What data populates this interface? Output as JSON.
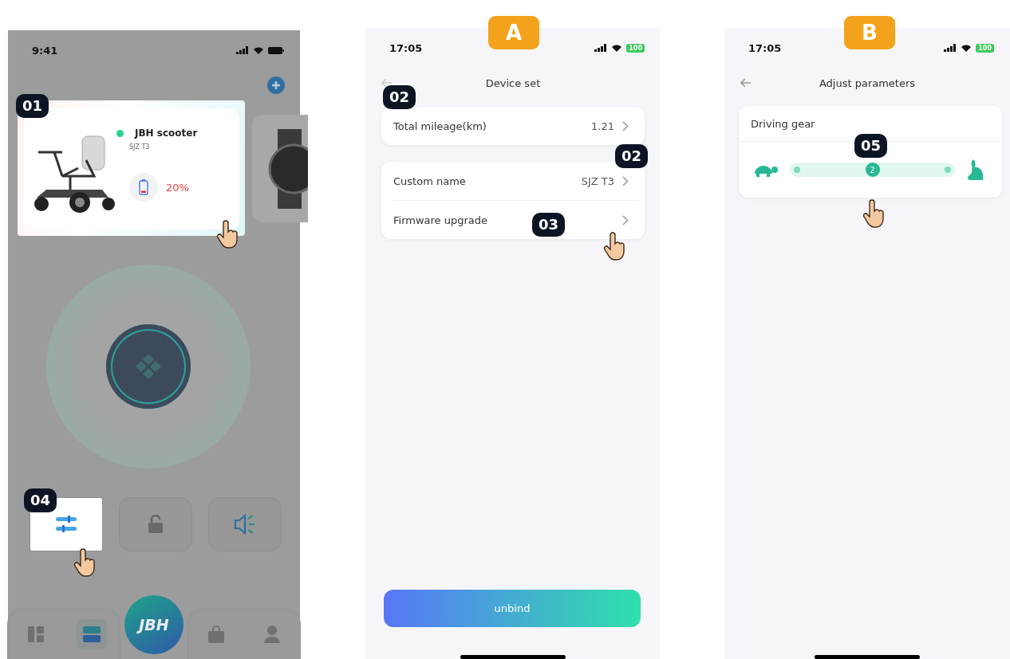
{
  "home_screen": {
    "status_time": "9:41",
    "device_card": {
      "name": "JBH scooter",
      "model": "SJZ T3",
      "online": true,
      "battery": "20%",
      "level": 0.2
    },
    "callouts": [
      "01",
      "04"
    ],
    "quick_actions": [
      {
        "kind": "adjust",
        "selected": true
      },
      {
        "kind": "lock",
        "selected": false
      },
      {
        "kind": "sound",
        "selected": false
      }
    ],
    "tab_bar": {
      "logo": "JBH",
      "tabs": [
        {
          "kind": "grid",
          "selected": false
        },
        {
          "kind": "devices",
          "selected": true
        },
        {
          "kind": "shop",
          "selected": false
        },
        {
          "kind": "profile",
          "selected": false
        }
      ]
    }
  },
  "device_set_screen": {
    "label": "A",
    "status_time": "17:05",
    "battery": "100",
    "title": "Device set",
    "groups": [
      [
        {
          "label": "Total mileage(km)",
          "value": "1.21"
        }
      ],
      [
        {
          "label": "Custom name",
          "value": "SJZ T3"
        },
        {
          "label": "Firmware upgrade"
        }
      ]
    ],
    "callouts": [
      "02",
      "02",
      "03"
    ],
    "button": "unbind"
  },
  "adjust_screen": {
    "label": "B",
    "status_time": "17:05",
    "battery": "100",
    "title": "Adjust parameters",
    "card_title": "Driving gear",
    "gear": {
      "value": "2",
      "level": 0.5
    },
    "callout": "05"
  }
}
